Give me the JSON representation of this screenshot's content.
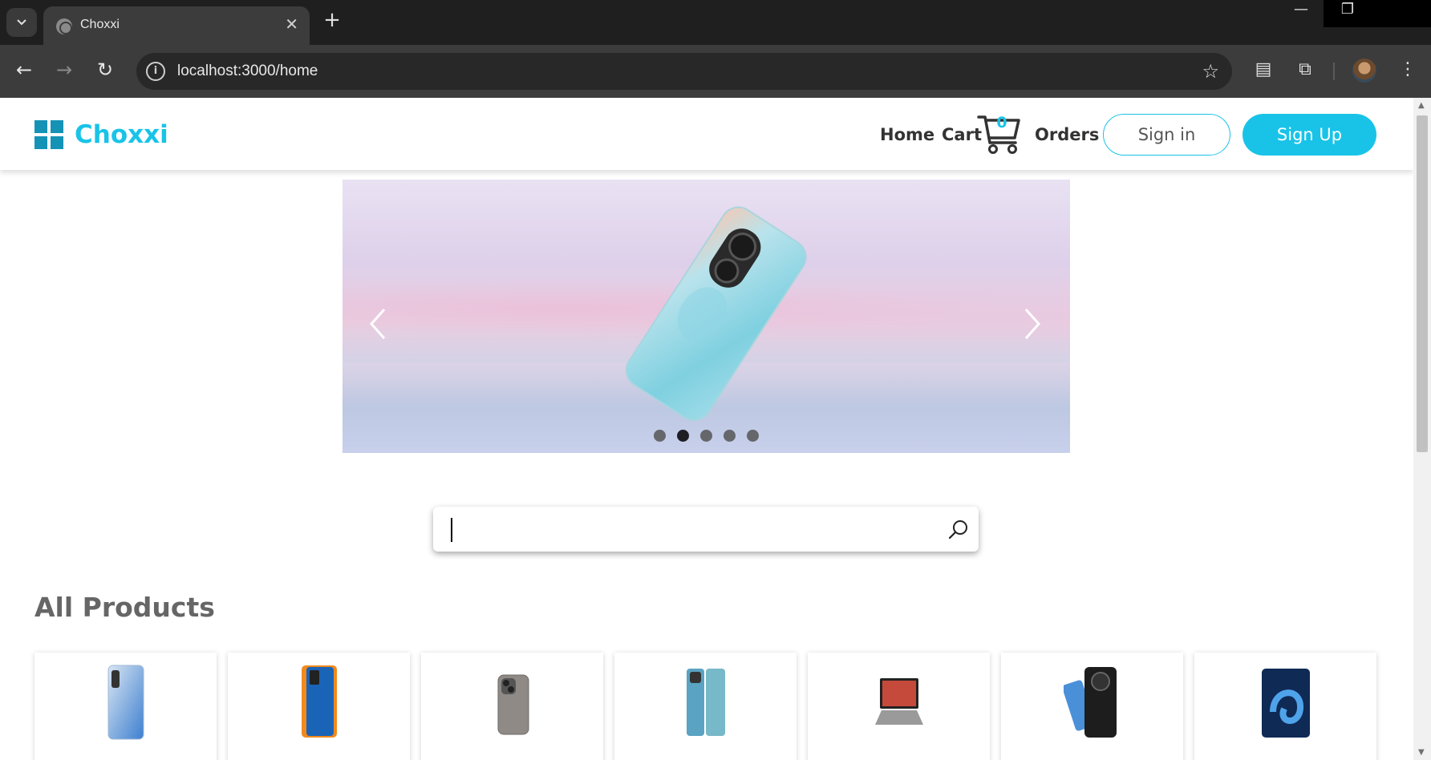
{
  "browser": {
    "tab_title": "Choxxi",
    "url": "localhost:3000/home"
  },
  "site": {
    "brand": "Choxxi",
    "nav": {
      "home": "Home",
      "cart": "Cart",
      "cart_count": "0",
      "orders": "Orders"
    },
    "sign_in": "Sign in",
    "sign_up": "Sign Up",
    "accent_color": "#19c3e8",
    "logo_color": "#1593b7"
  },
  "carousel": {
    "slide_count": 5,
    "active_slide": 2
  },
  "search": {
    "value": "",
    "placeholder": ""
  },
  "section": {
    "title": "All Products"
  },
  "products": [
    {
      "icon": "phone-blue-gradient"
    },
    {
      "icon": "phone-orange-blue"
    },
    {
      "icon": "phone-titanium"
    },
    {
      "icon": "phone-teal"
    },
    {
      "icon": "laptop"
    },
    {
      "icon": "phone-black-round-camera"
    },
    {
      "icon": "tablet-blue"
    }
  ]
}
